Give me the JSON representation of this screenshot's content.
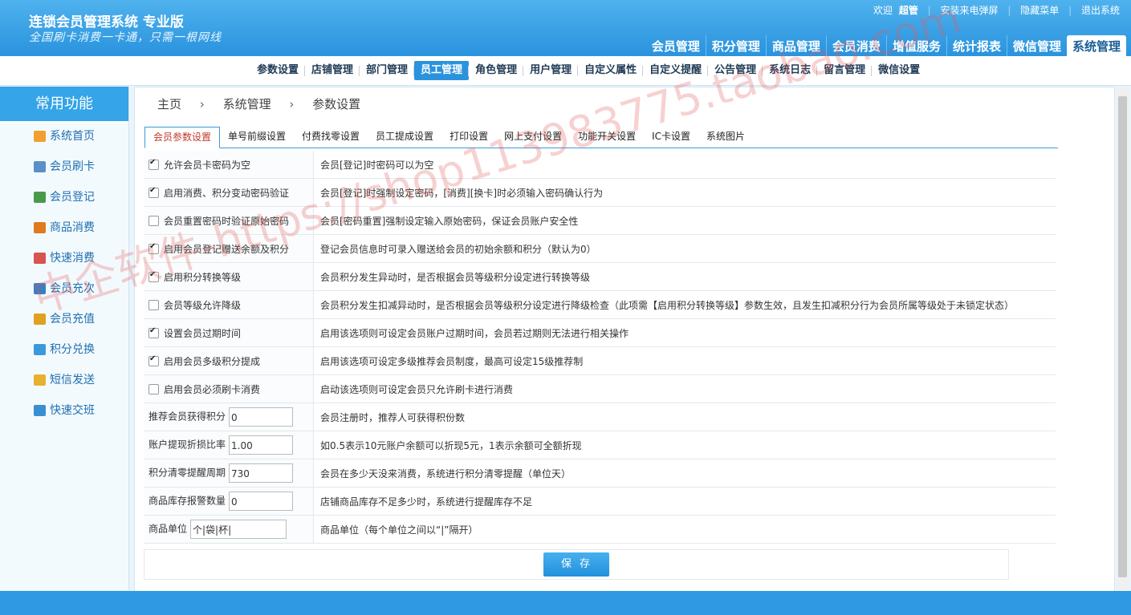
{
  "app": {
    "title": "连锁会员管理系统 专业版",
    "slogan": "全国刷卡消费一卡通，只需一根网线"
  },
  "top_links": {
    "welcome": "欢迎",
    "user": "超管",
    "caller_popup": "安装来电弹屏",
    "hide_menu": "隐藏菜单",
    "logout": "退出系统"
  },
  "main_nav": [
    "会员管理",
    "积分管理",
    "商品管理",
    "会员消费",
    "增值服务",
    "统计报表",
    "微信管理",
    "系统管理"
  ],
  "main_nav_active": "系统管理",
  "sub_nav": [
    "参数设置",
    "店铺管理",
    "部门管理",
    "员工管理",
    "角色管理",
    "用户管理",
    "自定义属性",
    "自定义提醒",
    "公告管理",
    "系统日志",
    "留言管理",
    "微信设置"
  ],
  "sub_nav_active": "员工管理",
  "sidebar": {
    "title": "常用功能",
    "items": [
      {
        "label": "系统首页",
        "icon": "home-icon",
        "color": "#f0a030"
      },
      {
        "label": "会员刷卡",
        "icon": "user-card-icon",
        "color": "#5a8fc8"
      },
      {
        "label": "会员登记",
        "icon": "users-icon",
        "color": "#4a9a4a"
      },
      {
        "label": "商品消费",
        "icon": "cart-icon",
        "color": "#e07a20"
      },
      {
        "label": "快速消费",
        "icon": "chart-icon",
        "color": "#d9534f"
      },
      {
        "label": "会员充次",
        "icon": "register-icon",
        "color": "#3a7fc0"
      },
      {
        "label": "会员充值",
        "icon": "coins-icon",
        "color": "#e0a020"
      },
      {
        "label": "积分兑换",
        "icon": "gift-icon",
        "color": "#3a9ad9"
      },
      {
        "label": "短信发送",
        "icon": "mail-icon",
        "color": "#e8b030"
      },
      {
        "label": "快速交班",
        "icon": "user-switch-icon",
        "color": "#3a8fd0"
      }
    ]
  },
  "breadcrumb": [
    "主页",
    "系统管理",
    "参数设置"
  ],
  "tabs": [
    "会员参数设置",
    "单号前缀设置",
    "付费找零设置",
    "员工提成设置",
    "打印设置",
    "网上支付设置",
    "功能开关设置",
    "IC卡设置",
    "系统图片"
  ],
  "tabs_active": "会员参数设置",
  "settings": [
    {
      "type": "checkbox",
      "checked": true,
      "label": "允许会员卡密码为空",
      "desc": "会员[登记]时密码可以为空"
    },
    {
      "type": "checkbox",
      "checked": true,
      "label": "启用消费、积分变动密码验证",
      "desc": "会员[登记]时强制设定密码，[消费][换卡]时必须输入密码确认行为"
    },
    {
      "type": "checkbox",
      "checked": false,
      "label": "会员重置密码时验证原始密码",
      "desc": "会员[密码重置]强制设定输入原始密码，保证会员账户安全性"
    },
    {
      "type": "checkbox",
      "checked": true,
      "label": "启用会员登记赠送余额及积分",
      "desc": "登记会员信息时可录入赠送给会员的初始余额和积分（默认为0）"
    },
    {
      "type": "checkbox",
      "checked": true,
      "label": "启用积分转换等级",
      "desc": "会员积分发生异动时，是否根据会员等级积分设定进行转换等级"
    },
    {
      "type": "checkbox",
      "checked": false,
      "label": "会员等级允许降级",
      "desc": "会员积分发生扣减异动时，是否根据会员等级积分设定进行降级检查（此项需【启用积分转换等级】参数生效，且发生扣减积分行为会员所属等级处于未锁定状态）"
    },
    {
      "type": "checkbox",
      "checked": true,
      "label": "设置会员过期时间",
      "desc": "启用该选项则可设定会员账户过期时间，会员若过期则无法进行相关操作"
    },
    {
      "type": "checkbox",
      "checked": true,
      "label": "启用会员多级积分提成",
      "desc": "启用该选项可设定多级推荐会员制度，最高可设定15级推荐制"
    },
    {
      "type": "checkbox",
      "checked": false,
      "label": "启用会员必须刷卡消费",
      "desc": "启动该选项则可设定会员只允许刷卡进行消费"
    },
    {
      "type": "input",
      "label": "推荐会员获得积分",
      "value": "0",
      "desc": "会员注册时，推荐人可获得积份数"
    },
    {
      "type": "input",
      "label": "账户提现折损比率",
      "value": "1.00",
      "desc": "如0.5表示10元账户余额可以折现5元，1表示余额可全额折现"
    },
    {
      "type": "input",
      "label": "积分清零提醒周期",
      "value": "730",
      "desc": "会员在多少天没来消费，系统进行积分清零提醒（单位天）"
    },
    {
      "type": "input",
      "label": "商品库存报警数量",
      "value": "0",
      "desc": "店铺商品库存不足多少时，系统进行提醒库存不足"
    },
    {
      "type": "input_wide",
      "label": "商品单位",
      "value": "个|袋|杯|",
      "desc": "商品单位（每个单位之间以“|”隔开）"
    }
  ],
  "save_label": "保存",
  "watermark": "中企软件-https://shop113983775.taobao.com",
  "colors": {
    "header": "#2a93de",
    "accent": "#2b93dd",
    "active_tab_text": "#c0392b"
  }
}
